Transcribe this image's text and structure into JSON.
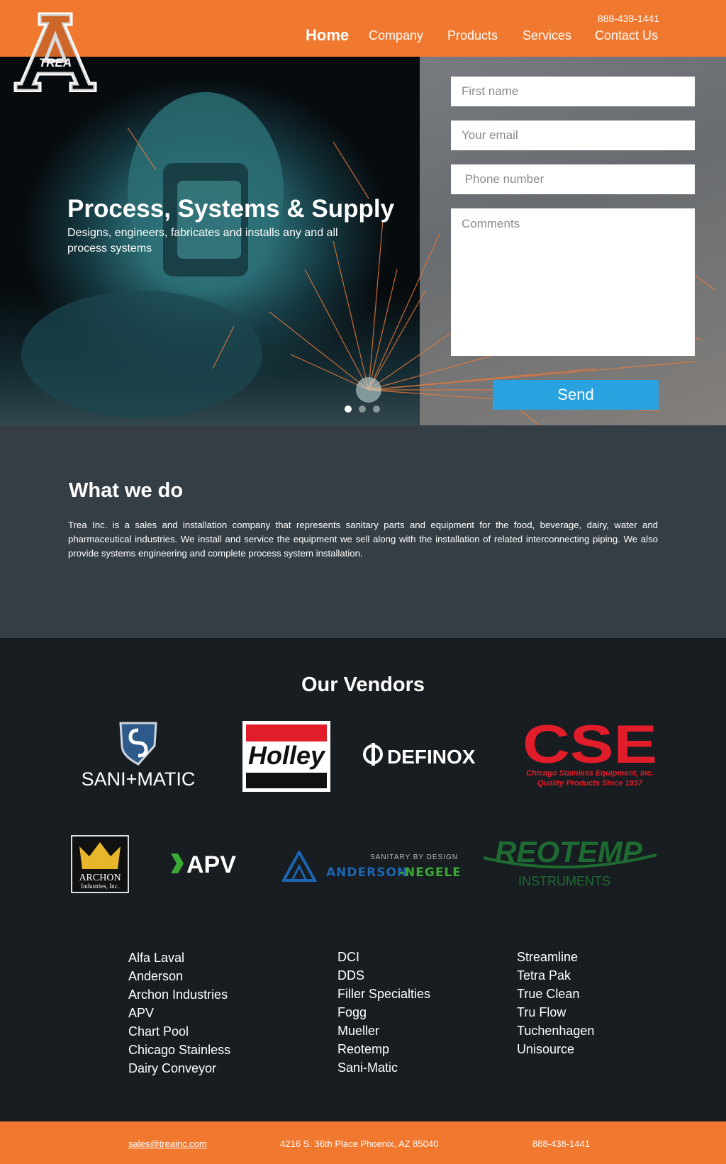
{
  "header": {
    "logo_text": "TREA",
    "phone": "888-438-1441",
    "nav": [
      {
        "label": "Home"
      },
      {
        "label": "Company"
      },
      {
        "label": "Products"
      },
      {
        "label": "Services"
      },
      {
        "label": "Contact Us"
      }
    ]
  },
  "hero": {
    "title": "Process, Systems & Supply",
    "subtitle": "Designs, engineers, fabricates and installs any and all process systems",
    "slides": 3,
    "active_slide": 1
  },
  "form": {
    "first_name_placeholder": "First name",
    "email_placeholder": "Your email",
    "phone_placeholder": " Phone number",
    "comments_placeholder": "Comments",
    "send_label": "Send"
  },
  "what_we_do": {
    "heading": "What we do",
    "body": "Trea Inc. is a sales and installation company that represents sanitary parts and equipment for the food, beverage, dairy, water and pharmaceutical industries. We install and service the equipment we sell along with the installation of related interconnecting piping. We also provide systems engineering and complete process system installation."
  },
  "vendors": {
    "heading": "Our Vendors",
    "logos": {
      "sanimatic": "SANI+MATIC",
      "holley": "Holley",
      "definox": "DEFINOX",
      "cse": "CSE",
      "cse_line1": "Chicago Stainless Equipment, Inc.",
      "cse_line2": "Quality Products Since 1937",
      "archon_line1": "ARCHON",
      "archon_line2": "Industries, Inc.",
      "apv": "APV",
      "anderson_tag": "SANITARY BY DESIGN",
      "anderson_a": "ANDERSON",
      "anderson_b": "-NEGELE",
      "reotemp": "REOTEMP",
      "reotemp_sub": "INSTRUMENTS"
    },
    "col1": [
      "Alfa Laval",
      "Anderson",
      "Archon Industries",
      "APV",
      "Chart Pool",
      "Chicago Stainless",
      "Dairy Conveyor"
    ],
    "col2": [
      "DCI",
      "DDS",
      "Filler Specialties",
      "Fogg",
      "Mueller",
      "Reotemp",
      "Sani-Matic"
    ],
    "col3": [
      "Streamline",
      "Tetra Pak",
      "True Clean",
      "Tru Flow",
      "Tuchenhagen",
      "Unisource"
    ]
  },
  "footer": {
    "email": "sales@treainc.com",
    "address": "4216 S. 36th Place Phoenix, AZ 85040",
    "phone": "888-438-1441"
  },
  "colors": {
    "brand_orange": "#f1782f",
    "send_blue": "#29a3e0",
    "section_gray": "#363e45",
    "dark": "#181d21"
  }
}
